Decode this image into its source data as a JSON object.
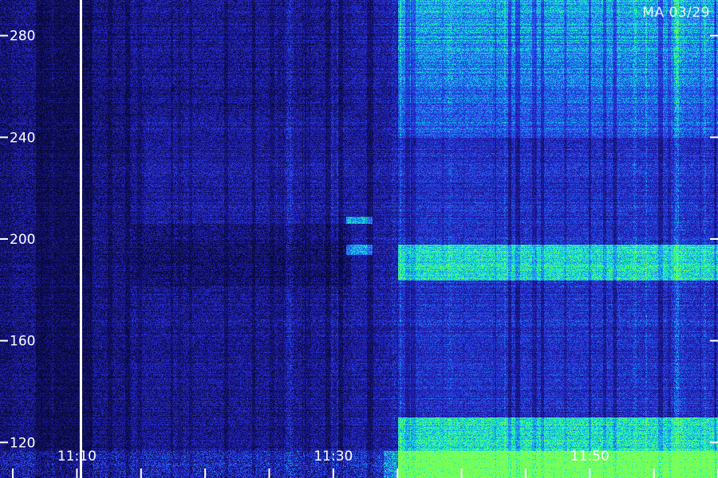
{
  "station_label": "MA 03/29",
  "colors": {
    "background": "#000000",
    "low": "#0a0a3a",
    "mid": "#2a2ad8",
    "high": "#18d8e0",
    "peak": "#30ff90",
    "marker": "#ffffff"
  },
  "chart_data": {
    "type": "heatmap",
    "title": "",
    "xlabel": "",
    "ylabel": "",
    "y_ticks": [
      280,
      240,
      200,
      160,
      120
    ],
    "x_ticks": [
      "11:10",
      "11:30",
      "11:50"
    ],
    "xlim": [
      "11:04",
      "12:00"
    ],
    "ylim": [
      106,
      294
    ],
    "y_scale": "linear",
    "grid": false,
    "event_marker_time": "11:10",
    "features": [
      {
        "kind": "enhanced_band",
        "start_time": "11:35",
        "end_time": "12:00",
        "y_range": [
          184,
          198
        ]
      },
      {
        "kind": "enhanced_band",
        "start_time": "11:35",
        "end_time": "12:00",
        "y_range": [
          106,
          130
        ]
      },
      {
        "kind": "enhanced_region",
        "start_time": "11:35",
        "end_time": "12:00",
        "y_range": [
          240,
          294
        ]
      },
      {
        "kind": "burst",
        "start_time": "11:31",
        "end_time": "11:33",
        "y_range": [
          194,
          198
        ]
      },
      {
        "kind": "burst",
        "start_time": "11:31",
        "end_time": "11:33",
        "y_range": [
          206,
          209
        ]
      }
    ]
  }
}
